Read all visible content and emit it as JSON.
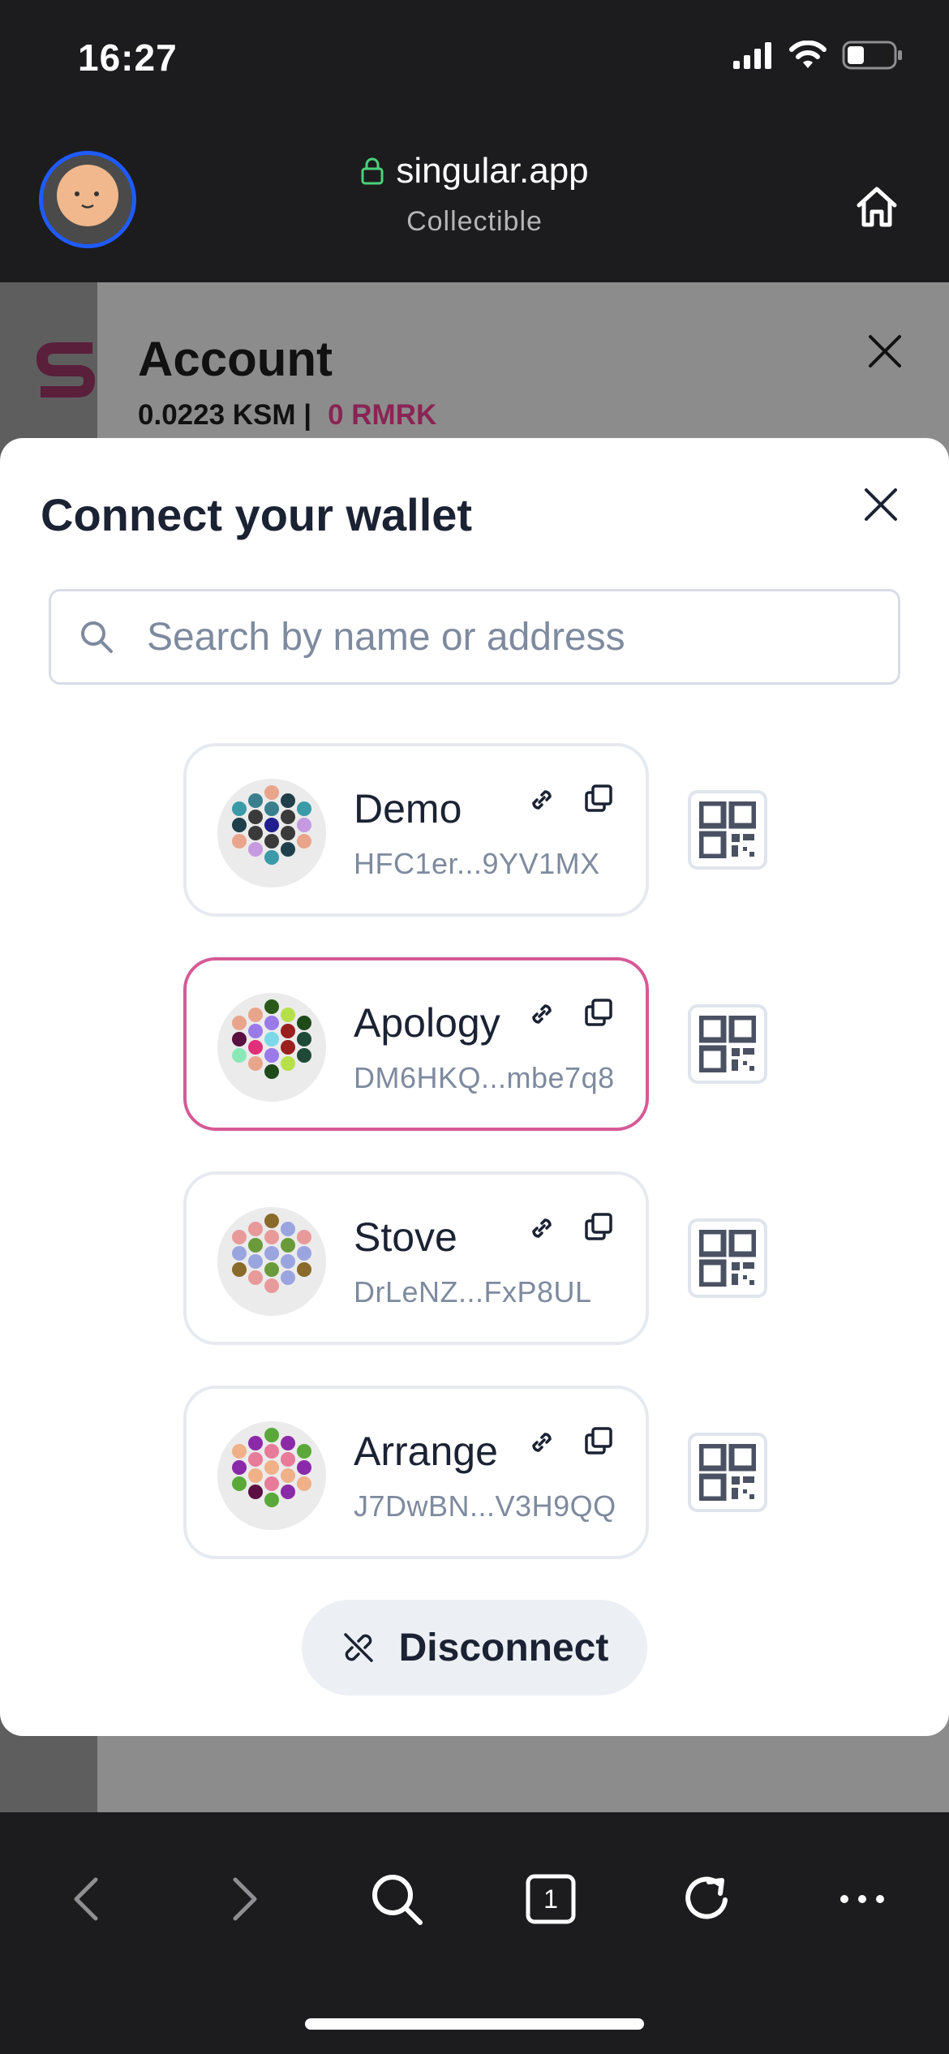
{
  "status_bar": {
    "time": "16:27"
  },
  "browser": {
    "domain": "singular.app",
    "subtitle": "Collectible"
  },
  "background_page": {
    "account_title": "Account",
    "balance_ksm": "0.0223 KSM |",
    "balance_rmrk": "0 RMRK"
  },
  "modal": {
    "title": "Connect your wallet",
    "search_placeholder": "Search by name or address",
    "accounts": [
      {
        "name": "Demo",
        "address": "HFC1er...9YV1MX",
        "selected": false
      },
      {
        "name": "Apology",
        "address": "DM6HKQ...mbe7q8",
        "selected": true
      },
      {
        "name": "Stove",
        "address": "DrLeNZ...FxP8UL",
        "selected": false
      },
      {
        "name": "Arrange",
        "address": "J7DwBN...V3H9QQ",
        "selected": false
      }
    ],
    "disconnect_label": "Disconnect"
  },
  "toolbar": {
    "tab_count": "1",
    "icons": [
      "back-icon",
      "forward-icon",
      "search-icon",
      "tabs-icon",
      "reload-icon",
      "more-icon"
    ]
  },
  "colors": {
    "selected_border": "#d65a96",
    "rmrk_accent": "#8a2454",
    "avatar_ring": "#1f5bff"
  }
}
